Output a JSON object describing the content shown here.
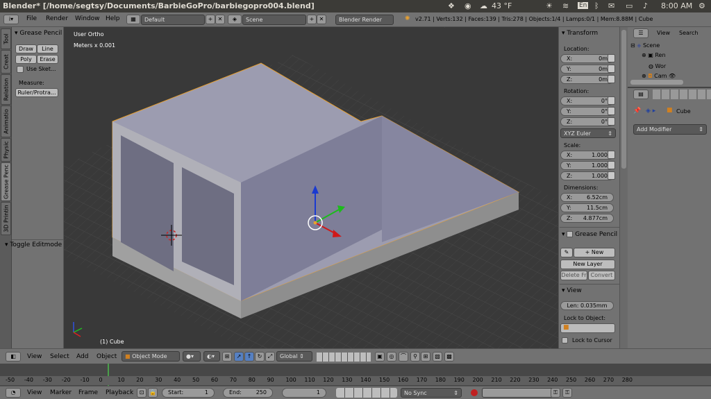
{
  "os": {
    "window_title": "Blender* [/home/segtsy/Documents/BarbieGoPro/barbiegopro004.blend]",
    "temperature": "43 °F",
    "keyboard": "En",
    "time": "8:00 AM"
  },
  "info_header": {
    "menus": [
      "File",
      "Render",
      "Window",
      "Help"
    ],
    "layout": "Default",
    "scene": "Scene",
    "engine": "Blender Render",
    "stats": "v2.71 | Verts:132 | Faces:139 | Tris:278 | Objects:1/4 | Lamps:0/1 | Mem:8.88M | Cube"
  },
  "tool_tabs": [
    "Tool",
    "Creat",
    "Relation",
    "Animatio",
    "Physic",
    "Grease Penc",
    "3D Printin"
  ],
  "tool_shelf": {
    "panel_title": "Grease Pencil",
    "draw": "Draw",
    "line": "Line",
    "poly": "Poly",
    "erase": "Erase",
    "use_sketching": "Use Sket...",
    "measure_label": "Measure:",
    "ruler": "Ruler/Protra...",
    "toggle_editmode": "Toggle Editmode"
  },
  "viewport": {
    "view_name": "User Ortho",
    "units": "Meters x 0.001",
    "object_label": "(1) Cube"
  },
  "n_panel": {
    "transform_title": "Transform",
    "location_label": "Location:",
    "location": [
      {
        "k": "X:",
        "v": "0m"
      },
      {
        "k": "Y:",
        "v": "0m"
      },
      {
        "k": "Z:",
        "v": "0m"
      }
    ],
    "rotation_label": "Rotation:",
    "rotation": [
      {
        "k": "X:",
        "v": "0°"
      },
      {
        "k": "Y:",
        "v": "0°"
      },
      {
        "k": "Z:",
        "v": "0°"
      }
    ],
    "rotation_mode": "XYZ Euler",
    "scale_label": "Scale:",
    "scale": [
      {
        "k": "X:",
        "v": "1.000"
      },
      {
        "k": "Y:",
        "v": "1.000"
      },
      {
        "k": "Z:",
        "v": "1.000"
      }
    ],
    "dimensions_label": "Dimensions:",
    "dimensions": [
      {
        "k": "X:",
        "v": "6.52cm"
      },
      {
        "k": "Y:",
        "v": "11.5cm"
      },
      {
        "k": "Z:",
        "v": "4.877cm"
      }
    ],
    "grease_title": "Grease Pencil",
    "new": "New",
    "new_layer": "New Layer",
    "delete_frame": "Delete Fr",
    "convert": "Convert",
    "view_title": "View",
    "lens": "Len: 0.035mm",
    "lock_to_object": "Lock to Object:",
    "lock_to_cursor": "Lock to Cursor"
  },
  "outliner": {
    "view_menu": "View",
    "search_menu": "Search",
    "items": [
      "Scene",
      "Ren",
      "Wor",
      "Cam"
    ]
  },
  "properties": {
    "object_name": "Cube",
    "add_modifier": "Add Modifier"
  },
  "view3d_header": {
    "view": "View",
    "select": "Select",
    "add": "Add",
    "object": "Object",
    "mode": "Object Mode",
    "orientation": "Global"
  },
  "timeline": {
    "ticks": [
      "-50",
      "-40",
      "-30",
      "-20",
      "-10",
      "0",
      "10",
      "20",
      "30",
      "40",
      "50",
      "60",
      "70",
      "80",
      "90",
      "100",
      "110",
      "120",
      "130",
      "140",
      "150",
      "160",
      "170",
      "180",
      "190",
      "200",
      "210",
      "220",
      "230",
      "240",
      "250",
      "260",
      "270",
      "280"
    ],
    "view": "View",
    "marker": "Marker",
    "frame": "Frame",
    "playback": "Playback",
    "start": "Start:",
    "start_value": "1",
    "end": "End:",
    "end_value": "250",
    "current": "1",
    "sync": "No Sync"
  }
}
